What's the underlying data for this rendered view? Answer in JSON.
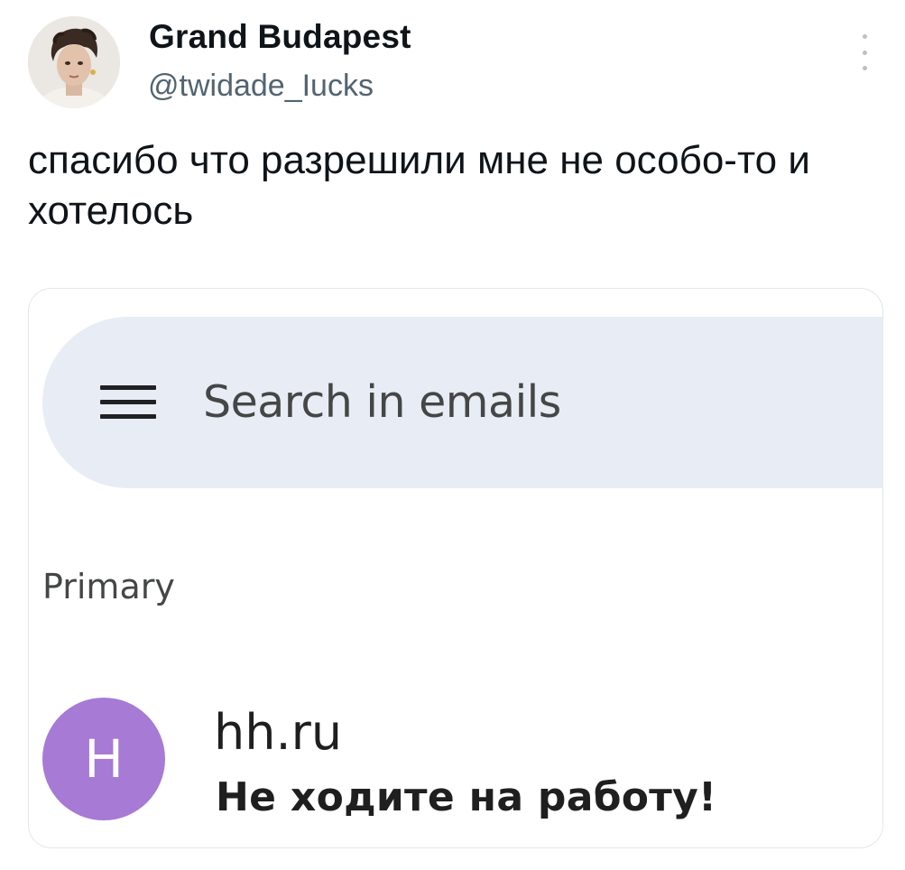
{
  "tweet": {
    "author": {
      "display_name": "Grand Budapest",
      "handle": "@twidade_Iucks",
      "avatar_icon": "user-avatar-photo"
    },
    "text": "спасибо что разрешили мне не особо-то и хотелось",
    "more_icon": "more-vertical-icon"
  },
  "screenshot": {
    "search": {
      "placeholder": "Search in emails",
      "menu_icon": "hamburger-menu-icon"
    },
    "section_label": "Primary",
    "emails": [
      {
        "avatar_letter": "H",
        "sender": "hh.ru",
        "subject": "Не ходите на работу!"
      }
    ]
  },
  "colors": {
    "search_bar_bg": "#e8edf5",
    "avatar_bg": "#a77ad6",
    "handle_color": "#536471",
    "text_color": "#0f1419"
  }
}
